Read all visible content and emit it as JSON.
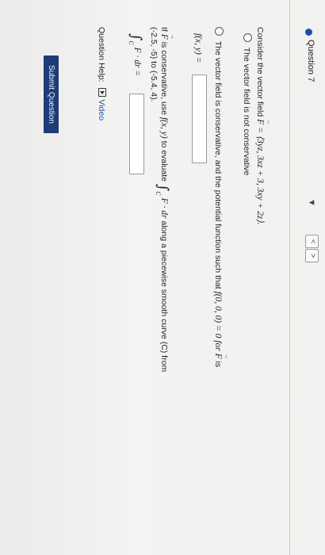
{
  "header": {
    "question_label": "Question 7",
    "dropdown_caret": "▼",
    "prev": "<",
    "next": ">"
  },
  "prompt": {
    "intro": "Consider the vector field",
    "field_lhs": "F",
    "field_eq": " = ⟨3yz, 3xz + 3, 3xy + 2z⟩."
  },
  "options": {
    "not_conservative": "The vector field is not conservative",
    "conservative_prefix": "The vector field is conservative, and the potential function such that",
    "conservative_condition": "f(0, 0, 0) = 0 for",
    "conservative_suffix_field": "F",
    "conservative_suffix": " is"
  },
  "potential": {
    "lhs": "f(x, y) =",
    "answer": ""
  },
  "evaluate": {
    "line1_prefix": "If",
    "field": "F",
    "line1_mid": "is conservative, use",
    "fxy": "f(x, y)",
    "line1_to": "to evaluate",
    "integral_part": "F · dr",
    "line1_suffix": "along a piecewise smooth curve (C) from",
    "line2": "(-2.5, -5) to (-5.4, 4).",
    "integral_lhs": "F · dr =",
    "answer": ""
  },
  "footer": {
    "help_label": "Question Help:",
    "video_label": "Video",
    "submit_label": "Submit Question"
  },
  "colors": {
    "accent": "#1d4fa8",
    "submit_bg": "#1d3c78"
  }
}
